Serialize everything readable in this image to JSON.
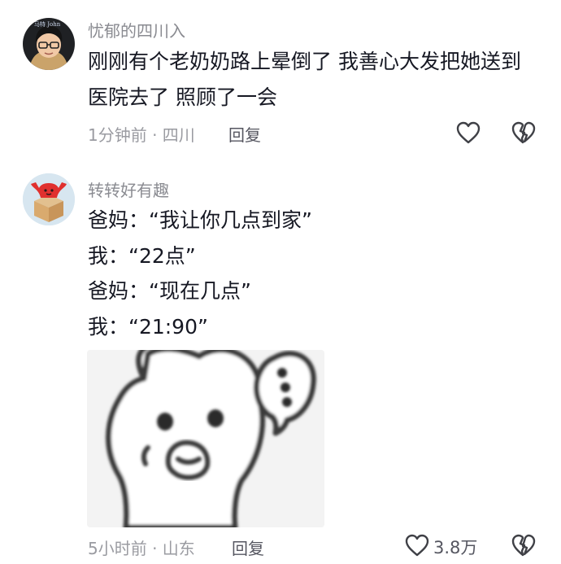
{
  "comments": [
    {
      "username": "忧郁的四川入",
      "avatar_text": "马特 John",
      "lines": [
        "刚刚有个老奶奶路上晕倒了 我善心大发把她送到",
        "医院去了 照顾了一会"
      ],
      "time": "1分钟前 · 四川",
      "reply": "回复",
      "like_icon": "heart-outline-icon",
      "dislike_icon": "broken-heart-icon"
    },
    {
      "username": "转转好有趣",
      "lines": [
        "爸妈：“我让你几点到家”",
        "我：“22点”",
        "爸妈：“现在几点”",
        "我：“21:90”"
      ],
      "sticker": "cat-meme-sticker",
      "time": "5小时前 · 山东",
      "reply": "回复",
      "like_count": "3.8万",
      "like_icon": "heart-outline-icon",
      "dislike_icon": "broken-heart-icon"
    }
  ],
  "colors": {
    "text": "#161823",
    "username": "#8a8b91",
    "meta": "#9a9ba1",
    "avatar2_bg": "#d7e6f0",
    "avatar2_accent": "#e0302e"
  }
}
